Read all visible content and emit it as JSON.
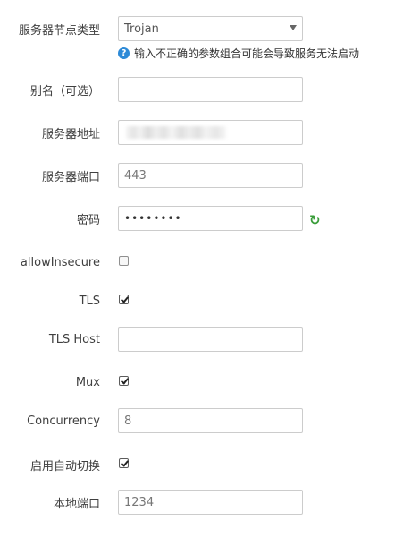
{
  "server_type": {
    "label": "服务器节点类型",
    "value": "Trojan",
    "hint": "输入不正确的参数组合可能会导致服务无法启动"
  },
  "alias": {
    "label": "别名（可选）",
    "value": ""
  },
  "server_address": {
    "label": "服务器地址",
    "value": ""
  },
  "server_port": {
    "label": "服务器端口",
    "value": "443"
  },
  "password": {
    "label": "密码",
    "value": "••••••••"
  },
  "allow_insecure": {
    "label": "allowInsecure",
    "checked": false
  },
  "tls": {
    "label": "TLS",
    "checked": true
  },
  "tls_host": {
    "label": "TLS Host",
    "value": ""
  },
  "mux": {
    "label": "Mux",
    "checked": true
  },
  "concurrency": {
    "label": "Concurrency",
    "value": "8"
  },
  "auto_switch": {
    "label": "启用自动切换",
    "checked": true
  },
  "local_port": {
    "label": "本地端口",
    "value": "1234"
  }
}
